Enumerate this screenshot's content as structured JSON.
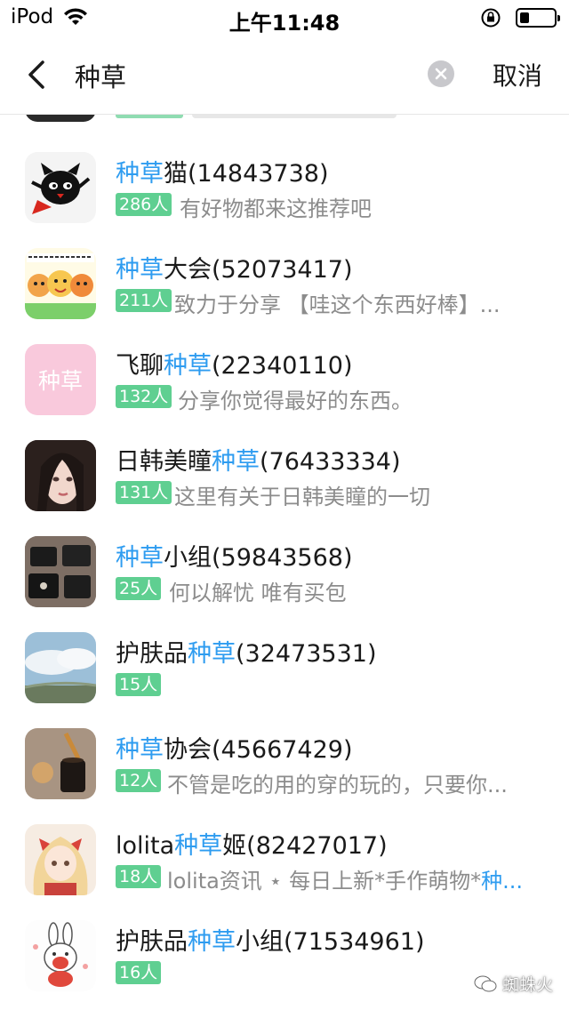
{
  "status_bar": {
    "carrier": "iPod",
    "time": "上午11:48"
  },
  "search": {
    "query": "种草",
    "cancel_label": "取消"
  },
  "colors": {
    "highlight": "#2e9cf0",
    "badge": "#5fcf91"
  },
  "results": [
    {
      "name_pre": "",
      "name_hl": "种草",
      "name_post": "猫(14843738)",
      "count": "286人",
      "desc": "有好物都来这推荐吧",
      "avatar": "cat-mascot-avatar"
    },
    {
      "name_pre": "",
      "name_hl": "种草",
      "name_post": "大会(52073417)",
      "count": "211人",
      "desc": "致力于分享 【哇这个东西好棒】...",
      "avatar": "cartoon-group-avatar"
    },
    {
      "name_pre": "飞聊",
      "name_hl": "种草",
      "name_post": "(22340110)",
      "count": "132人",
      "desc": "分享你觉得最好的东西。",
      "avatar": "pink-text-avatar",
      "avatar_text": "种草"
    },
    {
      "name_pre": "日韩美瞳",
      "name_hl": "种草",
      "name_post": "(76433334)",
      "count": "131人",
      "desc": "这里有关于日韩美瞳的一切",
      "avatar": "girl-portrait-avatar"
    },
    {
      "name_pre": "",
      "name_hl": "种草",
      "name_post": "小组(59843568)",
      "count": "25人",
      "desc": "何以解忧 唯有买包",
      "avatar": "handbags-avatar"
    },
    {
      "name_pre": "护肤品",
      "name_hl": "种草",
      "name_post": "(32473531)",
      "count": "15人",
      "desc": "",
      "avatar": "sky-clouds-avatar"
    },
    {
      "name_pre": "",
      "name_hl": "种草",
      "name_post": "协会(45667429)",
      "count": "12人",
      "desc": "不管是吃的用的穿的玩的，只要你...",
      "avatar": "honey-jar-avatar"
    },
    {
      "name_pre": "lolita",
      "name_hl": "种草",
      "name_post": "姬(82427017)",
      "count": "18人",
      "desc_pre": "lolita资讯 ⋆ 每日上新*手作萌物*",
      "desc_hl": "种...",
      "avatar": "anime-girl-avatar"
    },
    {
      "name_pre": "护肤品",
      "name_hl": "种草",
      "name_post": "小组(71534961)",
      "count": "16人",
      "desc": "",
      "avatar": "bunny-cartoon-avatar"
    }
  ],
  "watermark": "蜘蛛火"
}
